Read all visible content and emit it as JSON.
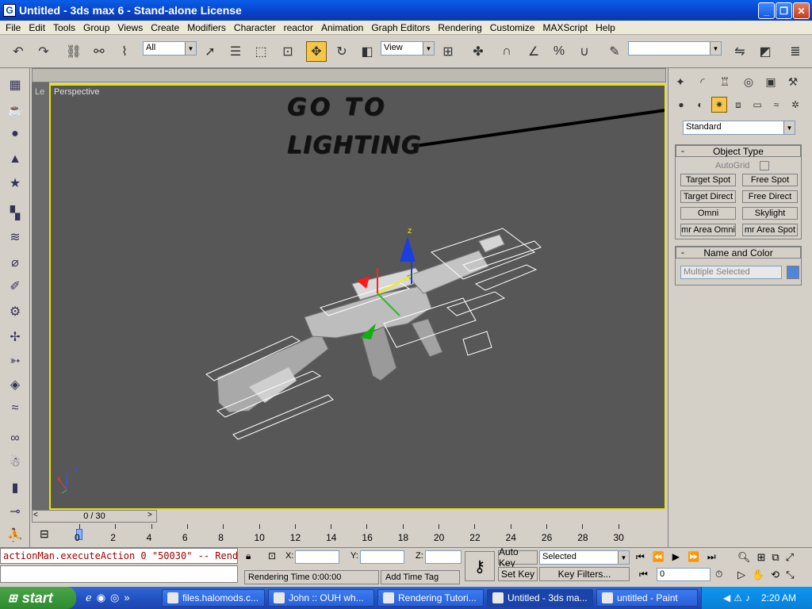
{
  "window": {
    "title": "Untitled - 3ds max 6 - Stand-alone License",
    "app_icon": "G"
  },
  "menu": [
    "File",
    "Edit",
    "Tools",
    "Group",
    "Views",
    "Create",
    "Modifiers",
    "Character",
    "reactor",
    "Animation",
    "Graph Editors",
    "Rendering",
    "Customize",
    "MAXScript",
    "Help"
  ],
  "toolbar": {
    "selection_filter": "All",
    "coord_system": "View",
    "named_selection": ""
  },
  "viewport": {
    "label": "Perspective",
    "side_label": "Le",
    "annotation_line1": "GO TO",
    "annotation_line2": "LIGHTING",
    "axis_x": "x",
    "axis_z": "z"
  },
  "timeline": {
    "frame_display": "0 / 30",
    "ticks": [
      "0",
      "2",
      "4",
      "6",
      "8",
      "10",
      "12",
      "14",
      "16",
      "18",
      "20",
      "22",
      "24",
      "26",
      "28",
      "30"
    ]
  },
  "command_panel": {
    "category": "Standard",
    "object_type_title": "Object Type",
    "autogrid_label": "AutoGrid",
    "buttons": [
      "Target Spot",
      "Free Spot",
      "Target Direct",
      "Free Direct",
      "Omni",
      "Skylight",
      "mr Area Omni",
      "mr Area Spot"
    ],
    "name_color_title": "Name and Color",
    "name_value": "Multiple Selected",
    "object_color": "#4f86d9"
  },
  "status": {
    "maxscript_line": "actionMan.executeAction 0 \"50030\"  -- Rend",
    "x_label": "X:",
    "y_label": "Y:",
    "z_label": "Z:",
    "rendering_time": "Rendering Time  0:00:00",
    "add_time_tag": "Add Time Tag",
    "auto_key": "Auto Key",
    "set_key": "Set Key",
    "key_mode": "Selected",
    "key_filters": "Key Filters...",
    "current_frame": "0"
  },
  "taskbar": {
    "start": "start",
    "tasks": [
      "files.halomods.c...",
      "John :: OUH wh...",
      "Rendering Tutori...",
      "Untitled - 3ds ma...",
      "untitled - Paint"
    ],
    "clock": "2:20 AM"
  }
}
